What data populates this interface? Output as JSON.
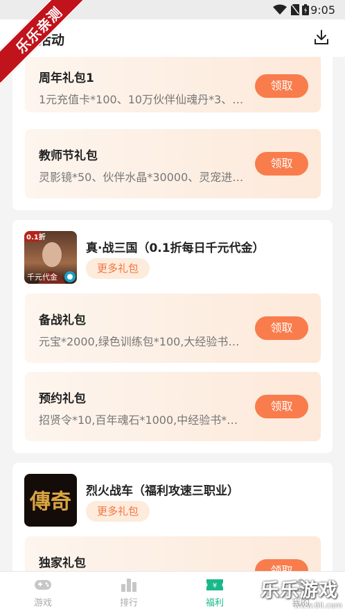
{
  "status_bar": {
    "time": "9:05"
  },
  "corner_ribbon": "乐乐亲测",
  "header": {
    "title": "新活动",
    "download_icon": "download-icon"
  },
  "cards": [
    {
      "gifts": [
        {
          "name": "周年礼包1",
          "desc": "1元充值卡*100、10万伙伴仙魂丹*3、伙伴",
          "button": "领取"
        },
        {
          "name": "教师节礼包",
          "desc": "灵影镜*50、伙伴水晶*30000、灵宠进阶丹",
          "button": "领取"
        }
      ]
    },
    {
      "game": {
        "title": "真·战三国（0.1折每日千元代金）",
        "more": "更多礼包",
        "icon_badge": "0.1折",
        "icon_caption": "千元代金"
      },
      "gifts": [
        {
          "name": "备战礼包",
          "desc": "元宝*2000,绿色训练包*100,大经验书*40",
          "button": "领取"
        },
        {
          "name": "预约礼包",
          "desc": "招贤令*10,百年魂石*1000,中经验书*300",
          "button": "领取"
        }
      ]
    },
    {
      "game": {
        "title": "烈火战车（福利攻速三职业）",
        "more": "更多礼包",
        "icon_text": "傳奇"
      },
      "gifts": [
        {
          "name": "独家礼包",
          "desc": "",
          "button": "领取"
        }
      ]
    }
  ],
  "bottom_nav": [
    {
      "label": "游戏",
      "icon": "gamepad-icon",
      "active": false
    },
    {
      "label": "排行",
      "icon": "ranking-icon",
      "active": false
    },
    {
      "label": "福利",
      "icon": "ticket-icon",
      "active": true
    },
    {
      "label": "我的",
      "icon": "user-icon",
      "active": false
    }
  ],
  "watermark": {
    "text": "乐乐游戏",
    "url": "www.6ll.com"
  },
  "colors": {
    "accent": "#f97c4c",
    "nav_active": "#18b88a",
    "ribbon": "#c1131b"
  }
}
